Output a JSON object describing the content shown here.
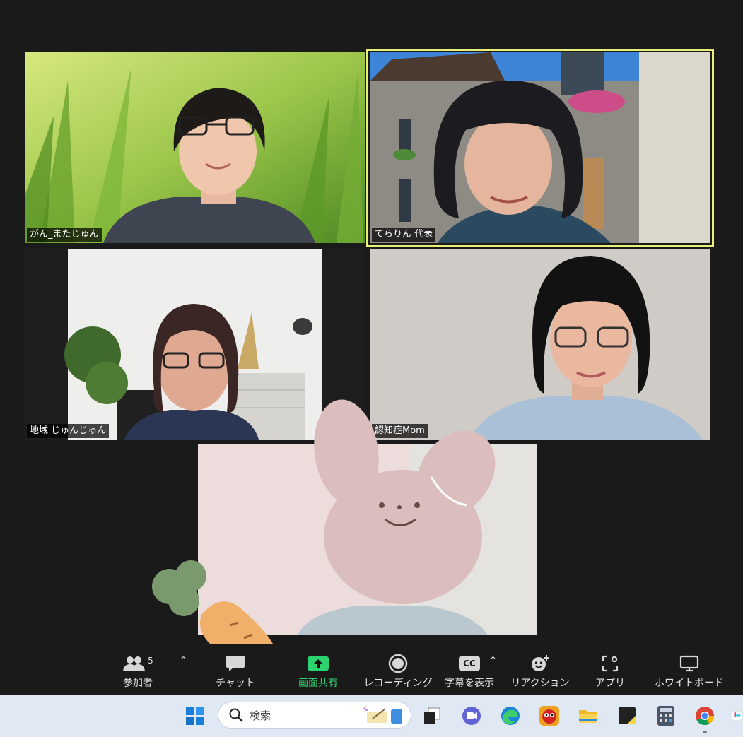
{
  "participants": [
    {
      "name": "がん_またじゅん"
    },
    {
      "name": "てらりん 代表"
    },
    {
      "name": "地域 じゅんじゅん"
    },
    {
      "name": "認知症Mom"
    },
    {
      "name": ""
    }
  ],
  "toolbar": {
    "participants_label": "参加者",
    "participants_count": "5",
    "chat_label": "チャット",
    "share_label": "画面共有",
    "record_label": "レコーディング",
    "captions_label": "字幕を表示",
    "captions_icon_text": "CC",
    "reactions_label": "リアクション",
    "apps_label": "アプリ",
    "whiteboard_label": "ホワイトボード"
  },
  "taskbar": {
    "search_placeholder": "検索"
  },
  "colors": {
    "background": "#1a1a1a",
    "active_speaker_border": "#e8f07a",
    "share_green": "#2dd36f",
    "taskbar": "#dfe8f3"
  },
  "icons": [
    "participants-icon",
    "chat-icon",
    "share-screen-icon",
    "record-icon",
    "captions-icon",
    "reactions-icon",
    "apps-icon",
    "whiteboard-icon",
    "windows-start-icon",
    "search-icon",
    "task-view-icon",
    "teams-icon",
    "edge-icon",
    "file-explorer-icon",
    "sticky-notes-icon",
    "calculator-icon",
    "chrome-icon"
  ]
}
